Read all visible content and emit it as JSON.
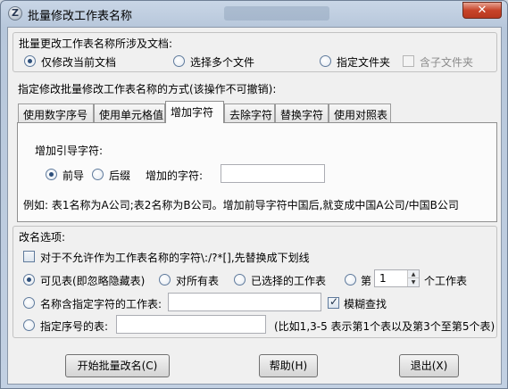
{
  "window": {
    "title": "批量修改工作表名称",
    "close_label": "✕"
  },
  "scope": {
    "heading": "批量更改工作表名称所涉及文档:",
    "opt_current": "仅修改当前文档",
    "opt_multi": "选择多个文件",
    "opt_folder": "指定文件夹",
    "opt_subfolder": "含子文件夹"
  },
  "method_heading": "指定修改批量修改工作表名称的方式(该操作不可撤销):",
  "tabs": [
    {
      "label": "使用数字序号"
    },
    {
      "label": "使用单元格值"
    },
    {
      "label": "增加字符"
    },
    {
      "label": "去除字符"
    },
    {
      "label": "替换字符"
    },
    {
      "label": "使用对照表"
    }
  ],
  "add_tab": {
    "position_label": "增加引导字符:",
    "opt_prefix": "前导",
    "opt_suffix": "后缀",
    "chars_label": "增加的字符:",
    "chars_value": "",
    "example": "例如: 表1名称为A公司;表2名称为B公司。增加前导字符中国后,就变成中国A公司/中国B公司"
  },
  "rename": {
    "heading": "改名选项:",
    "replace_invalid": "对于不允许作为工作表名称的字符\\:/?*[],先替换成下划线",
    "opt_visible": "可见表(即忽略隐藏表)",
    "opt_all": "对所有表",
    "opt_selected": "已选择的工作表",
    "opt_nth_prefix": "第",
    "nth_value": "1",
    "opt_nth_suffix": "个工作表",
    "opt_contains": "名称含指定字符的工作表:",
    "contains_value": "",
    "fuzzy_label": "模糊查找",
    "opt_index": "指定序号的表:",
    "index_value": "",
    "index_hint": "(比如1,3-5 表示第1个表以及第3个至第5个表)"
  },
  "buttons": {
    "start": "开始批量改名(C)",
    "help": "帮助(H)",
    "exit": "退出(X)"
  }
}
